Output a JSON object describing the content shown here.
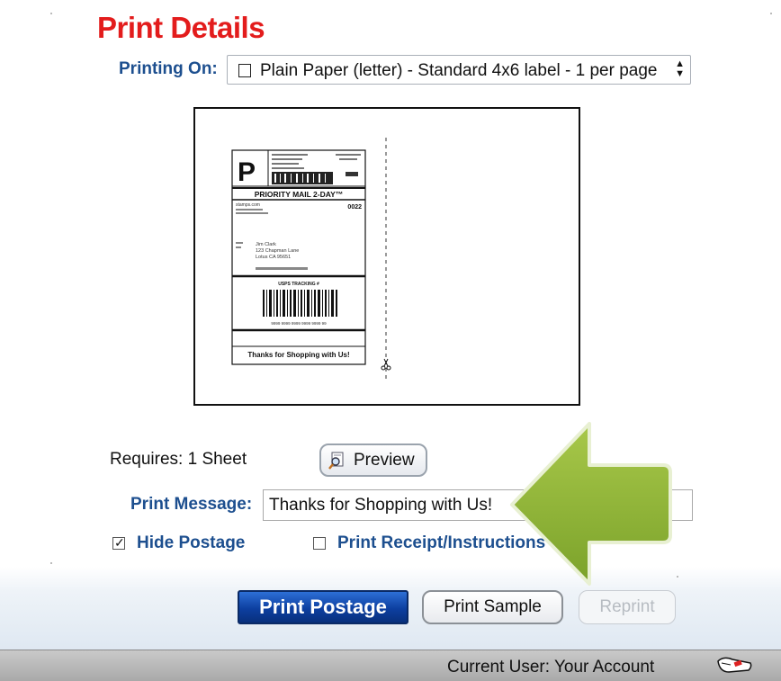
{
  "header": {
    "title": "Print Details"
  },
  "printing_on": {
    "label": "Printing On:",
    "selected_option": "Plain Paper (letter) - Standard 4x6 label - 1 per page"
  },
  "label_preview": {
    "service_letter": "P",
    "service_name": "PRIORITY MAIL 2-DAY™",
    "code": "0022",
    "from_line": "stamps.com",
    "recipient": [
      "Jim Clark",
      "123 Chapman Lane",
      "Lotus CA 95651"
    ],
    "tracking_heading": "USPS TRACKING #",
    "tracking_number": "9999 9999 9999 9999 9999 99",
    "message": "Thanks for Shopping with Us!"
  },
  "requires": {
    "text": "Requires:  1 Sheet"
  },
  "preview_button": {
    "label": "Preview",
    "icon": "magnifier-document-icon"
  },
  "print_message": {
    "label": "Print Message:",
    "value": "Thanks for Shopping with Us!"
  },
  "options": {
    "hide_postage": {
      "label": "Hide Postage",
      "checked": true
    },
    "print_receipt": {
      "label": "Print Receipt/Instructions",
      "checked": false
    }
  },
  "buttons": {
    "print_postage": "Print Postage",
    "print_sample": "Print Sample",
    "reprint": "Reprint"
  },
  "status_bar": {
    "text": "Current User: Your Account",
    "icon": "user-status-icon"
  },
  "colors": {
    "title": "#e31c1c",
    "label_blue": "#1d4f8f",
    "arrow_green": "#8db33a",
    "primary_button": "#0d3fa0"
  }
}
